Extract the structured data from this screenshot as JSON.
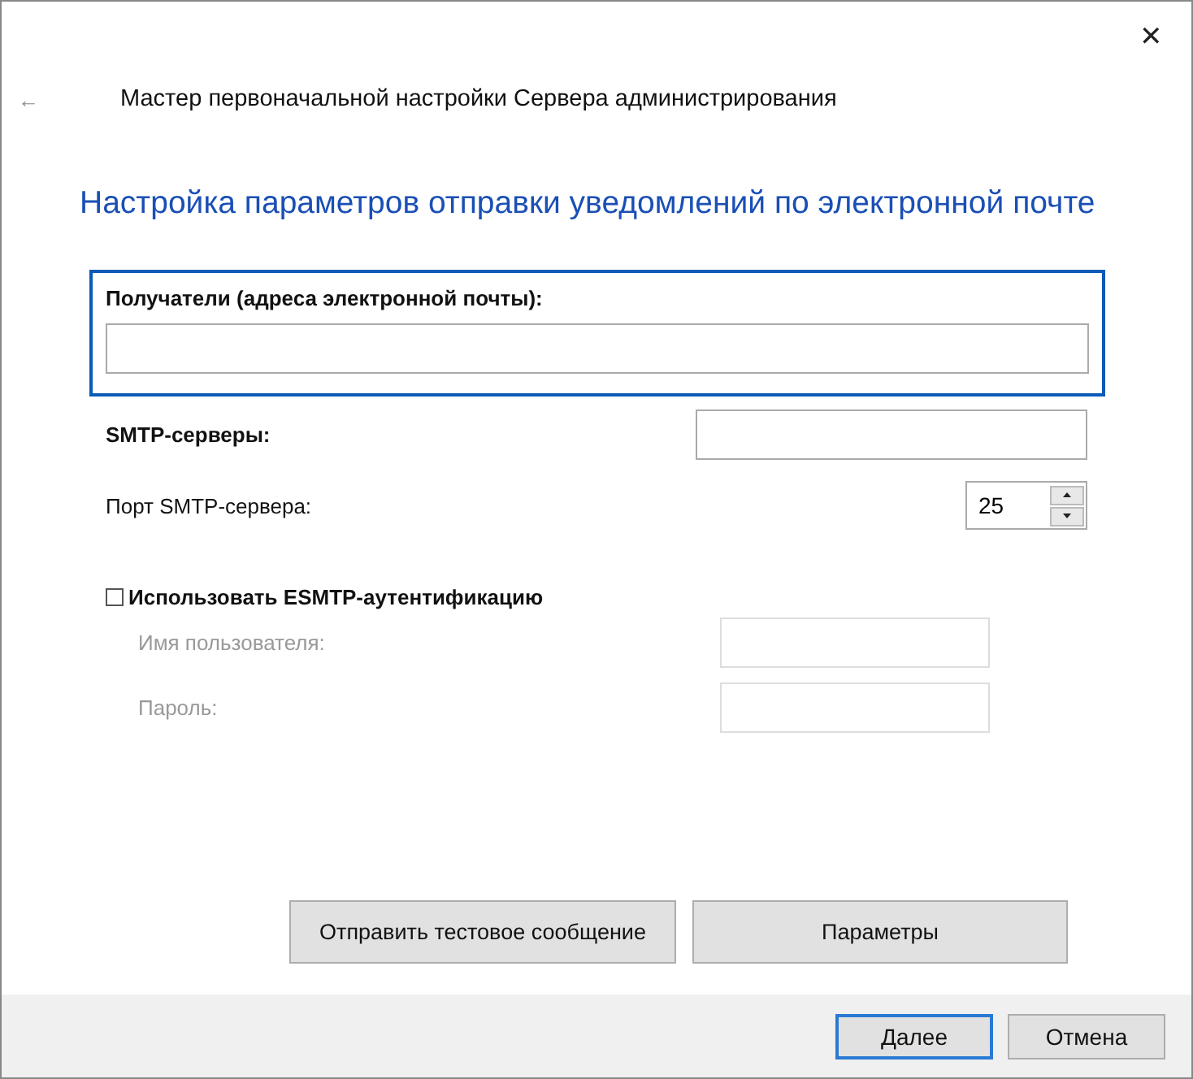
{
  "window": {
    "close": "✕",
    "back": "←",
    "title": "Мастер первоначальной настройки Сервера администрирования"
  },
  "heading": "Настройка параметров отправки уведомлений по электронной почте",
  "recipients": {
    "label": "Получатели (адреса электронной почты):",
    "focused": true
  },
  "fields": [
    {
      "kind": "text",
      "label": "SMTP-серверы:",
      "bold": true
    },
    {
      "kind": "spinner",
      "label": "Порт SMTP-сервера:",
      "bold": false,
      "value": "25"
    }
  ],
  "esmtp": {
    "label": "Использовать ESMTP-аутентификацию",
    "checked": false,
    "fields": [
      {
        "label": "Имя пользователя:",
        "disabled": true
      },
      {
        "label": "Пароль:",
        "disabled": true
      }
    ]
  },
  "actions": [
    "Отправить тестовое сообщение",
    "Параметры"
  ],
  "footer": [
    {
      "label": "Далее",
      "default": true
    },
    {
      "label": "Отмена",
      "default": false
    }
  ]
}
